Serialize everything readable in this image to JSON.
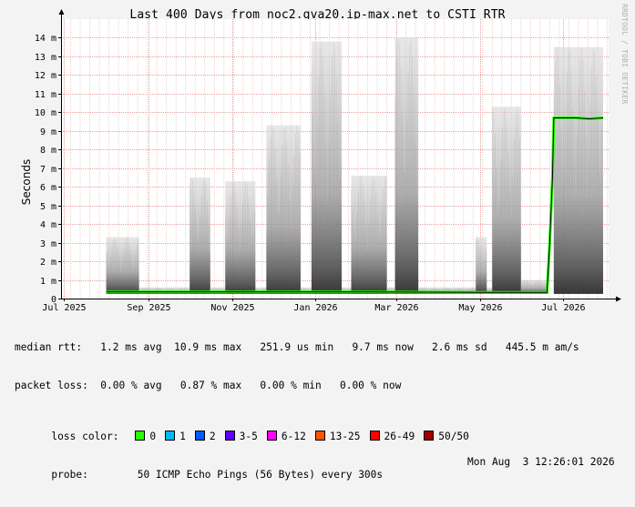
{
  "chart_data": {
    "type": "area",
    "title": "Last 400 Days from noc2.gva20.ip-max.net to CSTI_RTR",
    "ylabel": "Seconds",
    "watermark": "RRDTOOL / TOBI OETIKER",
    "ylim": [
      0,
      15
    ],
    "y_ticks": [
      {
        "value": 0,
        "label": "0"
      },
      {
        "value": 1,
        "label": "1 m"
      },
      {
        "value": 2,
        "label": "2 m"
      },
      {
        "value": 3,
        "label": "3 m"
      },
      {
        "value": 4,
        "label": "4 m"
      },
      {
        "value": 5,
        "label": "5 m"
      },
      {
        "value": 6,
        "label": "6 m"
      },
      {
        "value": 7,
        "label": "7 m"
      },
      {
        "value": 8,
        "label": "8 m"
      },
      {
        "value": 9,
        "label": "9 m"
      },
      {
        "value": 10,
        "label": "10 m"
      },
      {
        "value": 11,
        "label": "11 m"
      },
      {
        "value": 12,
        "label": "12 m"
      },
      {
        "value": 13,
        "label": "13 m"
      },
      {
        "value": 14,
        "label": "14 m"
      }
    ],
    "xlim": [
      "2025-06-29",
      "2026-08-03"
    ],
    "x_ticks": [
      {
        "date": "2025-07-01",
        "label": "Jul 2025"
      },
      {
        "date": "2025-09-01",
        "label": "Sep 2025"
      },
      {
        "date": "2025-11-01",
        "label": "Nov 2025"
      },
      {
        "date": "2026-01-01",
        "label": "Jan 2026"
      },
      {
        "date": "2026-03-01",
        "label": "Mar 2026"
      },
      {
        "date": "2026-05-01",
        "label": "May 2026"
      },
      {
        "date": "2026-07-01",
        "label": "Jul 2026"
      }
    ],
    "grid": true,
    "smoke_envelope": [
      {
        "start": "2025-08-01",
        "end": "2025-08-25",
        "max": 3.3
      },
      {
        "start": "2025-08-25",
        "end": "2025-10-01",
        "max": 0.6
      },
      {
        "start": "2025-10-01",
        "end": "2025-10-16",
        "max": 6.5
      },
      {
        "start": "2025-10-16",
        "end": "2025-10-27",
        "max": 0.6
      },
      {
        "start": "2025-10-27",
        "end": "2025-11-18",
        "max": 6.3
      },
      {
        "start": "2025-11-18",
        "end": "2025-11-26",
        "max": 0.6
      },
      {
        "start": "2025-11-26",
        "end": "2025-12-21",
        "max": 9.3
      },
      {
        "start": "2025-12-21",
        "end": "2025-12-29",
        "max": 0.6
      },
      {
        "start": "2025-12-29",
        "end": "2026-01-20",
        "max": 13.8
      },
      {
        "start": "2026-01-20",
        "end": "2026-01-27",
        "max": 0.6
      },
      {
        "start": "2026-01-27",
        "end": "2026-02-22",
        "max": 6.6
      },
      {
        "start": "2026-02-22",
        "end": "2026-02-28",
        "max": 0.6
      },
      {
        "start": "2026-02-28",
        "end": "2026-03-17",
        "max": 14.0
      },
      {
        "start": "2026-03-17",
        "end": "2026-04-28",
        "max": 0.6
      },
      {
        "start": "2026-04-28",
        "end": "2026-05-06",
        "max": 3.3
      },
      {
        "start": "2026-05-06",
        "end": "2026-05-10",
        "max": 0.6
      },
      {
        "start": "2026-05-10",
        "end": "2026-05-31",
        "max": 10.3
      },
      {
        "start": "2026-05-31",
        "end": "2026-06-20",
        "max": 1.0
      },
      {
        "start": "2026-06-24",
        "end": "2026-07-30",
        "max": 13.5
      }
    ],
    "median": [
      {
        "x": "2025-08-01",
        "y": 0.35
      },
      {
        "x": "2025-11-01",
        "y": 0.35
      },
      {
        "x": "2026-02-01",
        "y": 0.35
      },
      {
        "x": "2026-05-01",
        "y": 0.33
      },
      {
        "x": "2026-06-19",
        "y": 0.33
      },
      {
        "x": "2026-06-21",
        "y": 3.0
      },
      {
        "x": "2026-06-23",
        "y": 6.5
      },
      {
        "x": "2026-06-24",
        "y": 9.7
      },
      {
        "x": "2026-07-10",
        "y": 9.7
      },
      {
        "x": "2026-07-20",
        "y": 9.65
      },
      {
        "x": "2026-07-30",
        "y": 9.7
      }
    ],
    "loss_colors": [
      {
        "label": "0",
        "color": "#26ff00"
      },
      {
        "label": "1",
        "color": "#00b8ff"
      },
      {
        "label": "2",
        "color": "#0059ff"
      },
      {
        "label": "3-5",
        "color": "#5e00ff"
      },
      {
        "label": "6-12",
        "color": "#ff00ff"
      },
      {
        "label": "13-25",
        "color": "#ff5500"
      },
      {
        "label": "26-49",
        "color": "#ff0000"
      },
      {
        "label": "50/50",
        "color": "#a10000"
      }
    ]
  },
  "stats": {
    "median_rtt": "median rtt:   1.2 ms avg  10.9 ms max   251.9 us min   9.7 ms now   2.6 ms sd   445.5 m am/s",
    "packet_loss": "packet loss:  0.00 % avg   0.87 % max   0.00 % min   0.00 % now",
    "loss_color_label": "loss color:",
    "probe": "probe:        50 ICMP Echo Pings (56 Bytes) every 300s",
    "timestamp": "Mon Aug  3 12:26:01 2026"
  }
}
